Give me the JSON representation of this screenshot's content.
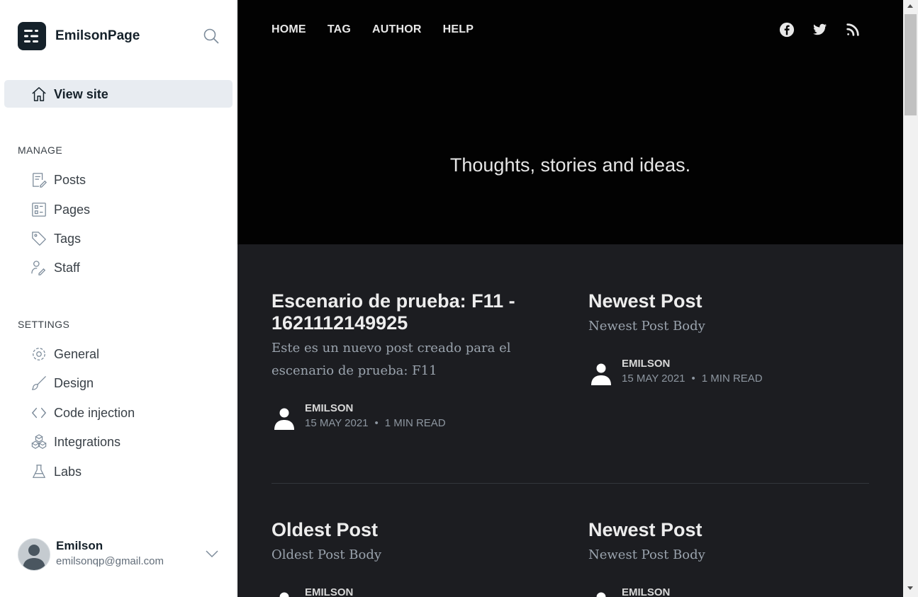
{
  "sidebar": {
    "brand_name": "EmilsonPage",
    "view_site_label": "View site",
    "manage_title": "MANAGE",
    "manage_items": [
      {
        "label": "Posts",
        "icon": "posts-icon"
      },
      {
        "label": "Pages",
        "icon": "pages-icon"
      },
      {
        "label": "Tags",
        "icon": "tag-icon"
      },
      {
        "label": "Staff",
        "icon": "staff-icon"
      }
    ],
    "settings_title": "SETTINGS",
    "settings_items": [
      {
        "label": "General",
        "icon": "gear-icon"
      },
      {
        "label": "Design",
        "icon": "brush-icon"
      },
      {
        "label": "Code injection",
        "icon": "code-icon"
      },
      {
        "label": "Integrations",
        "icon": "integrations-icon"
      },
      {
        "label": "Labs",
        "icon": "flask-icon"
      }
    ],
    "user": {
      "name": "Emilson",
      "email": "emilsonqp@gmail.com"
    }
  },
  "site": {
    "nav": [
      "HOME",
      "TAG",
      "AUTHOR",
      "HELP"
    ],
    "social": [
      "facebook-icon",
      "twitter-icon",
      "rss-icon"
    ],
    "tagline": "Thoughts, stories and ideas.",
    "posts": [
      {
        "title": "Escenario de prueba: F11 - 1621112149925",
        "excerpt": "Este es un nuevo post creado para el escenario de prueba: F11",
        "author": "EMILSON",
        "date": "15 MAY 2021",
        "read": "1 MIN READ"
      },
      {
        "title": "Newest Post",
        "excerpt": "Newest Post Body",
        "author": "EMILSON",
        "date": "15 MAY 2021",
        "read": "1 MIN READ"
      },
      {
        "title": "Oldest Post",
        "excerpt": "Oldest Post Body",
        "author": "EMILSON"
      },
      {
        "title": "Newest Post",
        "excerpt": "Newest Post Body",
        "author": "EMILSON"
      }
    ]
  },
  "colors": {
    "sidebar_bg": "#ffffff",
    "active_item_bg": "#e8ecf1",
    "hero_bg": "#020202",
    "content_bg": "#1c1d21",
    "text_dark": "#15212a"
  }
}
